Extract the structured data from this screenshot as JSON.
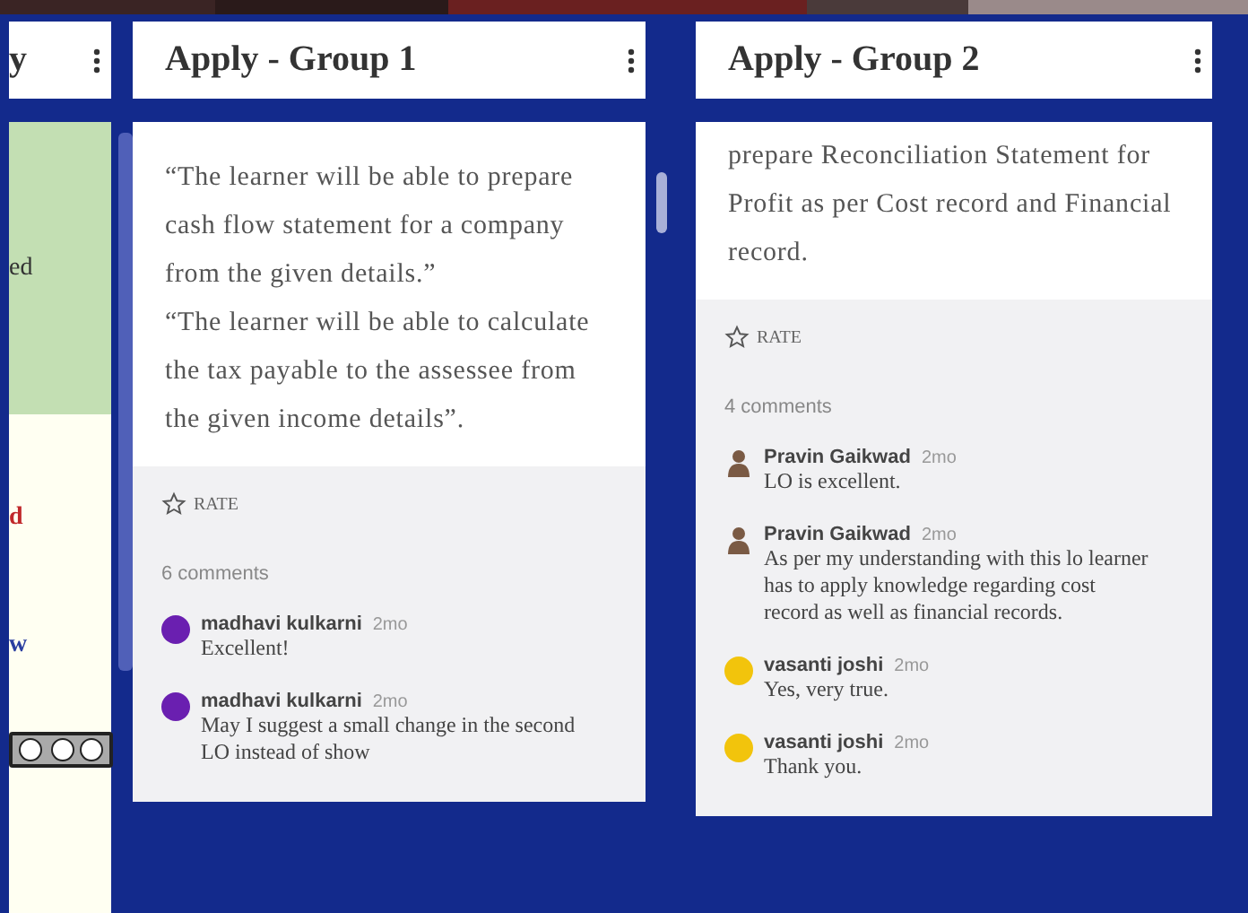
{
  "left_column": {
    "title": "y",
    "fragments": [
      {
        "text": "ed",
        "kind": "green"
      },
      {
        "text": "d",
        "kind": "red"
      },
      {
        "text": "w",
        "kind": "blue"
      }
    ]
  },
  "columns": [
    {
      "title": "Apply - Group 1",
      "paragraphs": [
        "“The learner will be able to prepare cash flow statement for a company from the given details.”",
        "“The learner will be able to calculate the tax payable to the assessee from the given income details”."
      ],
      "rate_label": "RATE",
      "comment_count": "6 comments",
      "comments": [
        {
          "author": "madhavi kulkarni",
          "time": "2mo",
          "text": "Excellent!",
          "kind": "circle",
          "color": "#6a1fb0"
        },
        {
          "author": "madhavi kulkarni",
          "time": "2mo",
          "text": "May I suggest a small change in the second LO instead of show",
          "kind": "circle",
          "color": "#6a1fb0"
        }
      ]
    },
    {
      "title": "Apply - Group 2",
      "paragraphs": [
        "prepare Reconciliation Statement for Profit as per Cost record and Financial record."
      ],
      "rate_label": "RATE",
      "comment_count": "4 comments",
      "comments": [
        {
          "author": "Pravin Gaikwad",
          "time": "2mo",
          "text": "LO is excellent.",
          "kind": "person",
          "color": "#7a5a44"
        },
        {
          "author": "Pravin Gaikwad",
          "time": "2mo",
          "text": "As per my understanding with this lo learner has to apply knowledge regarding cost record as well as financial records.",
          "kind": "person",
          "color": "#7a5a44"
        },
        {
          "author": "vasanti joshi",
          "time": "2mo",
          "text": "Yes, very true.",
          "kind": "circle",
          "color": "#f2c40c"
        },
        {
          "author": "vasanti joshi",
          "time": "2mo",
          "text": "Thank you.",
          "kind": "circle",
          "color": "#f2c40c"
        }
      ]
    }
  ]
}
